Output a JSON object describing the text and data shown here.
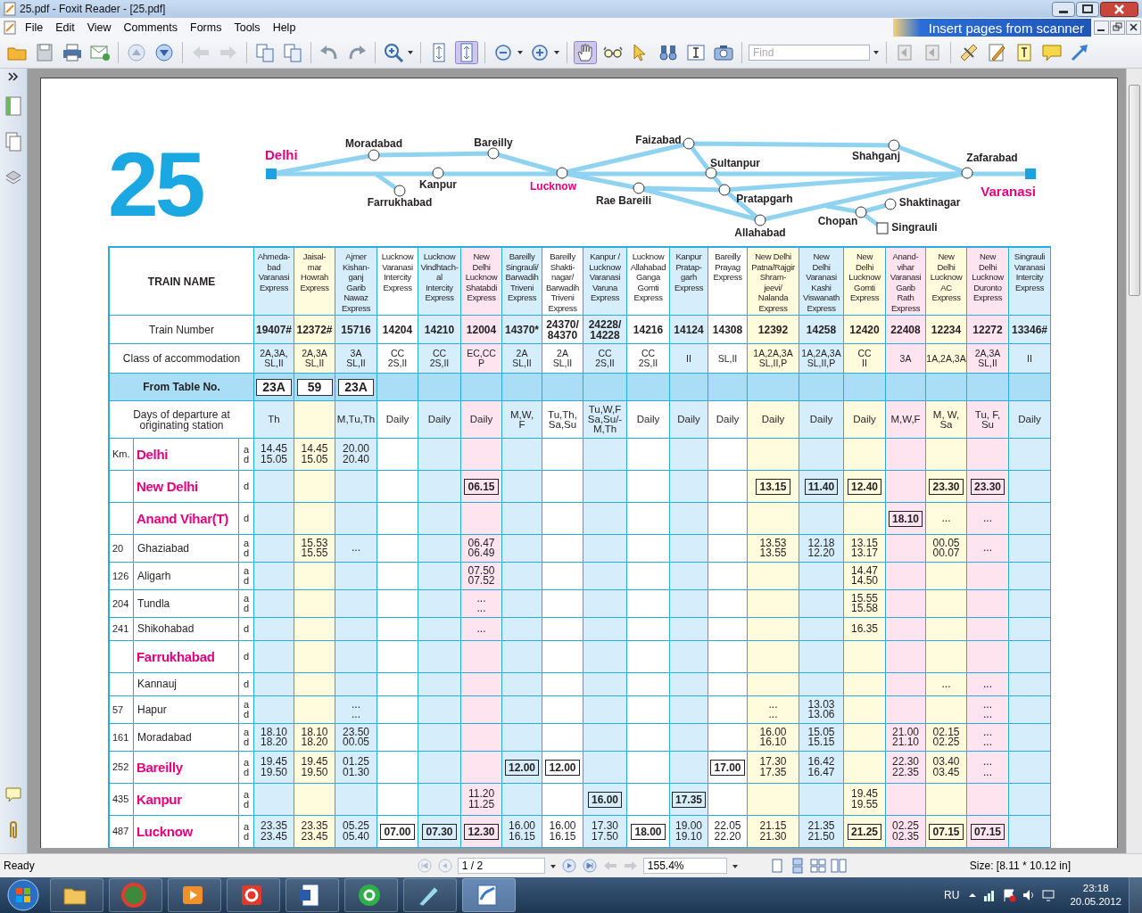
{
  "window": {
    "title": "25.pdf - Foxit Reader - [25.pdf]"
  },
  "menu": [
    "File",
    "Edit",
    "View",
    "Comments",
    "Forms",
    "Tools",
    "Help"
  ],
  "banner": "Insert pages from scanner",
  "toolbar": {
    "left_groups": [
      [
        {
          "kind": "open",
          "selected": false
        },
        {
          "kind": "save",
          "selected": false
        },
        {
          "kind": "print",
          "selected": false
        },
        {
          "kind": "email",
          "selected": false
        }
      ],
      [
        {
          "kind": "previous",
          "selected": false
        },
        {
          "kind": "next",
          "selected": false
        }
      ],
      [
        {
          "kind": "back",
          "selected": false
        },
        {
          "kind": "forward",
          "selected": false
        }
      ],
      [
        {
          "kind": "extract",
          "selected": false
        },
        {
          "kind": "insert",
          "selected": false
        }
      ],
      [
        {
          "kind": "undo",
          "selected": false
        },
        {
          "kind": "redo",
          "selected": false
        }
      ],
      [
        {
          "kind": "zoom",
          "selected": false
        },
        {
          "kind": "dropdown",
          "selected": false
        }
      ],
      [
        {
          "kind": "fitpage",
          "selected": false
        },
        {
          "kind": "fitwidth",
          "selected": true
        }
      ],
      [
        {
          "kind": "zoomout",
          "selected": false
        },
        {
          "kind": "dropdown",
          "selected": false
        },
        {
          "kind": "zoomin",
          "selected": false
        },
        {
          "kind": "dropdown",
          "selected": false
        }
      ],
      [
        {
          "kind": "hand",
          "selected": true
        },
        {
          "kind": "typewriter",
          "selected": false
        },
        {
          "kind": "select",
          "selected": false
        },
        {
          "kind": "binoculars",
          "selected": false
        },
        {
          "kind": "textselect",
          "selected": false
        },
        {
          "kind": "snapshot",
          "selected": false
        }
      ]
    ],
    "find": {
      "placeholder": "Find"
    },
    "right_groups": [
      [
        {
          "kind": "findprev",
          "selected": false
        },
        {
          "kind": "findnext",
          "selected": false
        }
      ],
      [
        {
          "kind": "ruler",
          "selected": false
        },
        {
          "kind": "pencil",
          "selected": false
        },
        {
          "kind": "textbox",
          "selected": false
        },
        {
          "kind": "note",
          "selected": false
        },
        {
          "kind": "arrow",
          "selected": false
        }
      ]
    ]
  },
  "page": {
    "table_number": "25",
    "map": {
      "stations": [
        {
          "name": "Delhi",
          "major": true,
          "kind": "terminal"
        },
        {
          "name": "Moradabad",
          "major": false,
          "kind": "stop"
        },
        {
          "name": "Bareilly",
          "major": false,
          "kind": "stop"
        },
        {
          "name": "Faizabad",
          "major": false,
          "kind": "stop"
        },
        {
          "name": "Shahganj",
          "major": false,
          "kind": "stop"
        },
        {
          "name": "Zafarabad",
          "major": false,
          "kind": "stop"
        },
        {
          "name": "Kanpur",
          "major": false,
          "kind": "stop"
        },
        {
          "name": "Sultanpur",
          "major": false,
          "kind": "stop"
        },
        {
          "name": "Lucknow",
          "major": true,
          "kind": "stop"
        },
        {
          "name": "Farrukhabad",
          "major": false,
          "kind": "stop"
        },
        {
          "name": "Rae Bareili",
          "major": false,
          "kind": "stop"
        },
        {
          "name": "Pratapgarh",
          "major": false,
          "kind": "stop"
        },
        {
          "name": "Varanasi",
          "major": true,
          "kind": "terminal"
        },
        {
          "name": "Shaktinagar",
          "major": false,
          "kind": "stop"
        },
        {
          "name": "Chopan",
          "major": false,
          "kind": "stop"
        },
        {
          "name": "Singrauli",
          "major": false,
          "kind": "end"
        },
        {
          "name": "Allahabad",
          "major": false,
          "kind": "stop"
        }
      ]
    },
    "timetable": {
      "labels": {
        "train_name": "TRAIN NAME",
        "train_number": "Train Number",
        "class": "Class of accommodation",
        "from_table": "From Table No.",
        "days": "Days of departure at\noriginating station"
      },
      "trains": [
        {
          "name": "Ahmeda-\nbad\nVaranasi\nExpress",
          "number": "19407#",
          "class": "2A,3A,\nSL,II",
          "table": "23A",
          "days": "Th",
          "color": "#d6eefb"
        },
        {
          "name": "Jaisal-\nmar\nHowrah\nExpress",
          "number": "12372#",
          "class": "2A,3A\nSL,II",
          "table": "59",
          "color": "#fffbdc"
        },
        {
          "name": "Ajmer\nKishan-\nganj\nGarib\nNawaz\nExpress",
          "number": "15716",
          "class": "3A\nSL,II",
          "table": "23A",
          "days": "M,Tu,Th",
          "color": "#d6eefb"
        },
        {
          "name": "Lucknow\nVaranasi\nIntercity\nExpress",
          "number": "14204",
          "class": "CC\n2S,II",
          "days": "Daily",
          "color": "#ffffff"
        },
        {
          "name": "Lucknow\nVindhtach-\nal\nIntercity\nExpress",
          "number": "14210",
          "class": "CC\n2S,II",
          "days": "Daily",
          "color": "#d6eefb"
        },
        {
          "name": "New\nDelhi\nLucknow\nShatabdi\nExpress",
          "number": "12004",
          "class": "EC,CC\nP",
          "days": "Daily",
          "color": "#fde4ef"
        },
        {
          "name": "Bareilly\nSingrauli/\nBarwadih\nTriveni\nExpress",
          "number": "14370*",
          "class": "2A\nSL,II",
          "days": "M,W,\nF",
          "color": "#d6eefb"
        },
        {
          "name": "Bareilly\nShakti-\nnagar/\nBarwadih\nTriveni\nExpress",
          "number": "24370/\n84370",
          "class": "2A\nSL,II",
          "days": "Tu,Th,\nSa,Su",
          "color": "#ffffff"
        },
        {
          "name": "Kanpur /\nLucknow\nVaranasi\nVaruna\nExpress",
          "number": "24228/\n14228",
          "class": "CC\n2S,II",
          "days": "Tu,W,F\nSa,Su/-\nM,Th",
          "color": "#d6eefb"
        },
        {
          "name": "Lucknow\nAllahabad\nGanga\nGomti\nExpress",
          "number": "14216",
          "class": "CC\n2S,II",
          "days": "Daily",
          "color": "#ffffff"
        },
        {
          "name": "Kanpur\nPratap-\ngarh\nExpress",
          "number": "14124",
          "class": "II",
          "days": "Daily",
          "color": "#d6eefb"
        },
        {
          "name": "Bareilly\nPrayag\nExpress",
          "number": "14308",
          "class": "SL,II",
          "days": "Daily",
          "color": "#ffffff"
        },
        {
          "name": "New Delhi\nPatna/Rajgir\nShram-\njeevi/\nNalanda\nExpress",
          "number": "12392",
          "class": "1A,2A,3A\nSL,II,P",
          "days": "Daily",
          "color": "#fffbdc"
        },
        {
          "name": "New\nDelhi\nVaranasi\nKashi\nViswanath\nExpress",
          "number": "14258",
          "class": "1A,2A,3A\nSL,II,P",
          "days": "Daily",
          "color": "#d6eefb"
        },
        {
          "name": "New\nDelhi\nLucknow\nGomti\nExpress",
          "number": "12420",
          "class": "CC\nII",
          "days": "Daily",
          "color": "#fffbdc"
        },
        {
          "name": "Anand-\nvihar\nVaranasi\nGarib\nRath\nExpress",
          "number": "22408",
          "class": "3A",
          "days": "M,W,F",
          "color": "#fde4ef"
        },
        {
          "name": "New\nDelhi\nLucknow\nAC\nExpress",
          "number": "12234",
          "class": "1A,2A,3A",
          "days": "M, W,\nSa",
          "color": "#fffbdc"
        },
        {
          "name": "New\nDelhi\nLucknow\nDuronto\nExpress",
          "number": "12272",
          "class": "2A,3A\nSL,II",
          "days": "Tu, F,\nSu",
          "color": "#fde4ef"
        },
        {
          "name": "Singrauli\nVaranasi\nIntercity\nExpress",
          "number": "13346#",
          "class": "II",
          "days": "Daily",
          "color": "#d6eefb"
        }
      ],
      "stations": [
        {
          "km": "Km.",
          "name": "Delhi",
          "major": true,
          "ad": [
            "a",
            "d"
          ],
          "cells": [
            {
              "lines": [
                "14.45",
                "15.05"
              ],
              "boxed": false
            },
            {
              "lines": [
                "14.45",
                "15.05"
              ],
              "boxed": false
            },
            {
              "lines": [
                "20.00",
                "20.40"
              ],
              "boxed": false
            },
            null,
            null,
            null,
            null,
            null,
            null,
            null,
            null,
            null,
            null,
            null,
            null,
            null,
            null,
            null,
            null
          ]
        },
        {
          "name": "New Delhi",
          "major": true,
          "ad": [
            "d"
          ],
          "cells": [
            null,
            null,
            null,
            null,
            null,
            {
              "lines": [
                "06.15"
              ],
              "boxed": true
            },
            null,
            null,
            null,
            null,
            null,
            null,
            {
              "lines": [
                "13.15"
              ],
              "boxed": true
            },
            {
              "lines": [
                "11.40"
              ],
              "boxed": true
            },
            {
              "lines": [
                "12.40"
              ],
              "boxed": true
            },
            null,
            {
              "lines": [
                "23.30"
              ],
              "boxed": true
            },
            {
              "lines": [
                "23.30"
              ],
              "boxed": true
            },
            null
          ]
        },
        {
          "name": "Anand Vihar(T)",
          "major": true,
          "ad": [
            "d"
          ],
          "cells": [
            null,
            null,
            null,
            null,
            null,
            null,
            null,
            null,
            null,
            null,
            null,
            null,
            null,
            null,
            null,
            {
              "lines": [
                "18.10"
              ],
              "boxed": true
            },
            {
              "lines": [
                "..."
              ],
              "boxed": false
            },
            {
              "lines": [
                "..."
              ],
              "boxed": false
            },
            null
          ]
        },
        {
          "km": "20",
          "name": "Ghaziabad",
          "major": false,
          "ad": [
            "a",
            "d"
          ],
          "cells": [
            null,
            {
              "lines": [
                "15.53",
                "15.55"
              ],
              "boxed": false
            },
            {
              "lines": [
                "..."
              ],
              "boxed": false
            },
            null,
            null,
            {
              "lines": [
                "06.47",
                "06.49"
              ],
              "boxed": false
            },
            null,
            null,
            null,
            null,
            null,
            null,
            {
              "lines": [
                "13.53",
                "13.55"
              ],
              "boxed": false
            },
            {
              "lines": [
                "12.18",
                "12.20"
              ],
              "boxed": false
            },
            {
              "lines": [
                "13.15",
                "13.17"
              ],
              "boxed": false
            },
            null,
            {
              "lines": [
                "00.05",
                "00.07"
              ],
              "boxed": false
            },
            {
              "lines": [
                "..."
              ],
              "boxed": false
            },
            null
          ]
        },
        {
          "km": "126",
          "name": "Aligarh",
          "major": false,
          "ad": [
            "a",
            "d"
          ],
          "cells": [
            null,
            null,
            null,
            null,
            null,
            {
              "lines": [
                "07.50",
                "07.52"
              ],
              "boxed": false
            },
            null,
            null,
            null,
            null,
            null,
            null,
            null,
            null,
            {
              "lines": [
                "14.47",
                "14.50"
              ],
              "boxed": false
            },
            null,
            null,
            null,
            null
          ]
        },
        {
          "km": "204",
          "name": "Tundla",
          "major": false,
          "ad": [
            "a",
            "d"
          ],
          "cells": [
            null,
            null,
            null,
            null,
            null,
            {
              "lines": [
                "...",
                "..."
              ],
              "boxed": false
            },
            null,
            null,
            null,
            null,
            null,
            null,
            null,
            null,
            {
              "lines": [
                "15.55",
                "15.58"
              ],
              "boxed": false
            },
            null,
            null,
            null,
            null
          ]
        },
        {
          "km": "241",
          "name": "Shikohabad",
          "major": false,
          "ad": [
            "d"
          ],
          "cells": [
            null,
            null,
            null,
            null,
            null,
            {
              "lines": [
                "..."
              ],
              "boxed": false
            },
            null,
            null,
            null,
            null,
            null,
            null,
            null,
            null,
            {
              "lines": [
                "16.35"
              ],
              "boxed": false
            },
            null,
            null,
            null,
            null
          ]
        },
        {
          "name": "Farrukhabad",
          "major": true,
          "ad": [
            "d"
          ],
          "cells": [
            null,
            null,
            null,
            null,
            null,
            null,
            null,
            null,
            null,
            null,
            null,
            null,
            null,
            null,
            null,
            null,
            null,
            null,
            null
          ]
        },
        {
          "name": "Kannauj",
          "major": false,
          "ad": [
            "d"
          ],
          "cells": [
            null,
            null,
            null,
            null,
            null,
            null,
            null,
            null,
            null,
            null,
            null,
            null,
            null,
            null,
            null,
            null,
            {
              "lines": [
                "..."
              ],
              "boxed": false
            },
            {
              "lines": [
                "..."
              ],
              "boxed": false
            },
            null
          ]
        },
        {
          "km": "57",
          "name": "Hapur",
          "major": false,
          "ad": [
            "a",
            "d"
          ],
          "cells": [
            null,
            null,
            {
              "lines": [
                "...",
                "..."
              ],
              "boxed": false
            },
            null,
            null,
            null,
            null,
            null,
            null,
            null,
            null,
            null,
            {
              "lines": [
                "...",
                "..."
              ],
              "boxed": false
            },
            {
              "lines": [
                "13.03",
                "13.06"
              ],
              "boxed": false
            },
            null,
            null,
            null,
            {
              "lines": [
                "...",
                "..."
              ],
              "boxed": false
            },
            null
          ]
        },
        {
          "km": "161",
          "name": "Moradabad",
          "major": false,
          "ad": [
            "a",
            "d"
          ],
          "cells": [
            {
              "lines": [
                "18.10",
                "18.20"
              ],
              "boxed": false
            },
            {
              "lines": [
                "18.10",
                "18.20"
              ],
              "boxed": false
            },
            {
              "lines": [
                "23.50",
                "00.05"
              ],
              "boxed": false
            },
            null,
            null,
            null,
            null,
            null,
            null,
            null,
            null,
            null,
            {
              "lines": [
                "16.00",
                "16.10"
              ],
              "boxed": false
            },
            {
              "lines": [
                "15.05",
                "15.15"
              ],
              "boxed": false
            },
            null,
            {
              "lines": [
                "21.00",
                "21.10"
              ],
              "boxed": false
            },
            {
              "lines": [
                "02.15",
                "02.25"
              ],
              "boxed": false
            },
            {
              "lines": [
                "...",
                "..."
              ],
              "boxed": false
            },
            null
          ]
        },
        {
          "km": "252",
          "name": "Bareilly",
          "major": true,
          "ad": [
            "a",
            "d"
          ],
          "cells": [
            {
              "lines": [
                "19.45",
                "19.50"
              ],
              "boxed": false
            },
            {
              "lines": [
                "19.45",
                "19.50"
              ],
              "boxed": false
            },
            {
              "lines": [
                "01.25",
                "01.30"
              ],
              "boxed": false
            },
            null,
            null,
            null,
            {
              "lines": [
                "12.00"
              ],
              "boxed": true
            },
            {
              "lines": [
                "12.00"
              ],
              "boxed": true
            },
            null,
            null,
            null,
            {
              "lines": [
                "17.00"
              ],
              "boxed": true
            },
            {
              "lines": [
                "17.30",
                "17.35"
              ],
              "boxed": false
            },
            {
              "lines": [
                "16.42",
                "16.47"
              ],
              "boxed": false
            },
            null,
            {
              "lines": [
                "22.30",
                "22.35"
              ],
              "boxed": false
            },
            {
              "lines": [
                "03.40",
                "03.45"
              ],
              "boxed": false
            },
            {
              "lines": [
                "...",
                "..."
              ],
              "boxed": false
            },
            null
          ]
        },
        {
          "km": "435",
          "name": "Kanpur",
          "major": true,
          "ad": [
            "a",
            "d"
          ],
          "cells": [
            null,
            null,
            null,
            null,
            null,
            {
              "lines": [
                "11.20",
                "11.25"
              ],
              "boxed": false
            },
            null,
            null,
            {
              "lines": [
                "16.00"
              ],
              "boxed": true
            },
            null,
            {
              "lines": [
                "17.35"
              ],
              "boxed": true
            },
            null,
            null,
            null,
            {
              "lines": [
                "19.45",
                "19.55"
              ],
              "boxed": false
            },
            null,
            null,
            null,
            null
          ]
        },
        {
          "km": "487",
          "name": "Lucknow",
          "major": true,
          "ad": [
            "a",
            "d"
          ],
          "cells": [
            {
              "lines": [
                "23.35",
                "23.45"
              ],
              "boxed": false
            },
            {
              "lines": [
                "23.35",
                "23.45"
              ],
              "boxed": false
            },
            {
              "lines": [
                "05.25",
                "05.40"
              ],
              "boxed": false
            },
            {
              "lines": [
                "07.00"
              ],
              "boxed": true
            },
            {
              "lines": [
                "07.30"
              ],
              "boxed": true
            },
            {
              "lines": [
                "12.30"
              ],
              "boxed": true
            },
            {
              "lines": [
                "16.00",
                "16.15"
              ],
              "boxed": false
            },
            {
              "lines": [
                "16.00",
                "16.15"
              ],
              "boxed": false
            },
            {
              "lines": [
                "17.30",
                "17.50"
              ],
              "boxed": false
            },
            {
              "lines": [
                "18.00"
              ],
              "boxed": true
            },
            {
              "lines": [
                "19.00",
                "19.10"
              ],
              "boxed": false
            },
            {
              "lines": [
                "22.05",
                "22.20"
              ],
              "boxed": false
            },
            {
              "lines": [
                "21.15",
                "21.30"
              ],
              "boxed": false
            },
            {
              "lines": [
                "21.35",
                "21.50"
              ],
              "boxed": false
            },
            {
              "lines": [
                "21.25"
              ],
              "boxed": true
            },
            {
              "lines": [
                "02.25",
                "02.35"
              ],
              "boxed": false
            },
            {
              "lines": [
                "07.15"
              ],
              "boxed": true
            },
            {
              "lines": [
                "07.15"
              ],
              "boxed": true
            },
            null
          ]
        }
      ]
    }
  },
  "status_bar": {
    "status": "Ready",
    "page": "1 / 2",
    "zoom": "155.4%",
    "size": "Size: [8.11 * 10.12 in]"
  },
  "taskbar": {
    "language": "RU",
    "time": "23:18",
    "date": "20.05.2012"
  }
}
